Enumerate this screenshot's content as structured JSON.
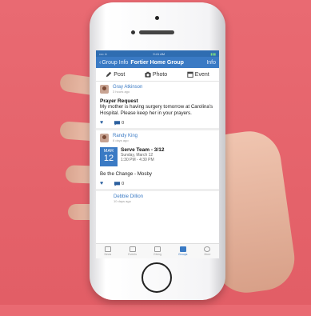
{
  "status_bar": {
    "carrier": "•••• ≎",
    "time": "9:41 AM",
    "battery": "▮▮▮"
  },
  "nav": {
    "back_label": "Group Info",
    "title": "Fortier Home Group",
    "info_label": "Info"
  },
  "actions": [
    {
      "label": "Post",
      "icon": "pencil-icon"
    },
    {
      "label": "Photo",
      "icon": "camera-icon"
    },
    {
      "label": "Event",
      "icon": "calendar-icon"
    }
  ],
  "posts": [
    {
      "author": "Gray Atkinson",
      "time": "3 hours ago",
      "title": "Prayer Request",
      "body": "My mother is having surgery tomorrow at Carolina's Hospital.  Please keep her in your prayers.",
      "comments": "0"
    },
    {
      "author": "Randy King",
      "time": "8 days ago",
      "event": {
        "month": "MAR",
        "day": "12",
        "title": "Serve Team - 3/12",
        "date": "Sunday, March 12",
        "time": "1:30 PM - 4:30 PM"
      },
      "body": "Be the Change - Mosby",
      "comments": "0"
    },
    {
      "author": "Debbie Dillion",
      "time": "10 days ago"
    }
  ],
  "tabs": [
    {
      "label": "News",
      "icon": "news-icon"
    },
    {
      "label": "Events",
      "icon": "events-icon"
    },
    {
      "label": "Giving",
      "icon": "giving-icon"
    },
    {
      "label": "Groups",
      "icon": "groups-icon",
      "active": true
    },
    {
      "label": "More",
      "icon": "more-icon"
    }
  ],
  "colors": {
    "accent": "#3a7ac4",
    "background": "#e25e66"
  }
}
